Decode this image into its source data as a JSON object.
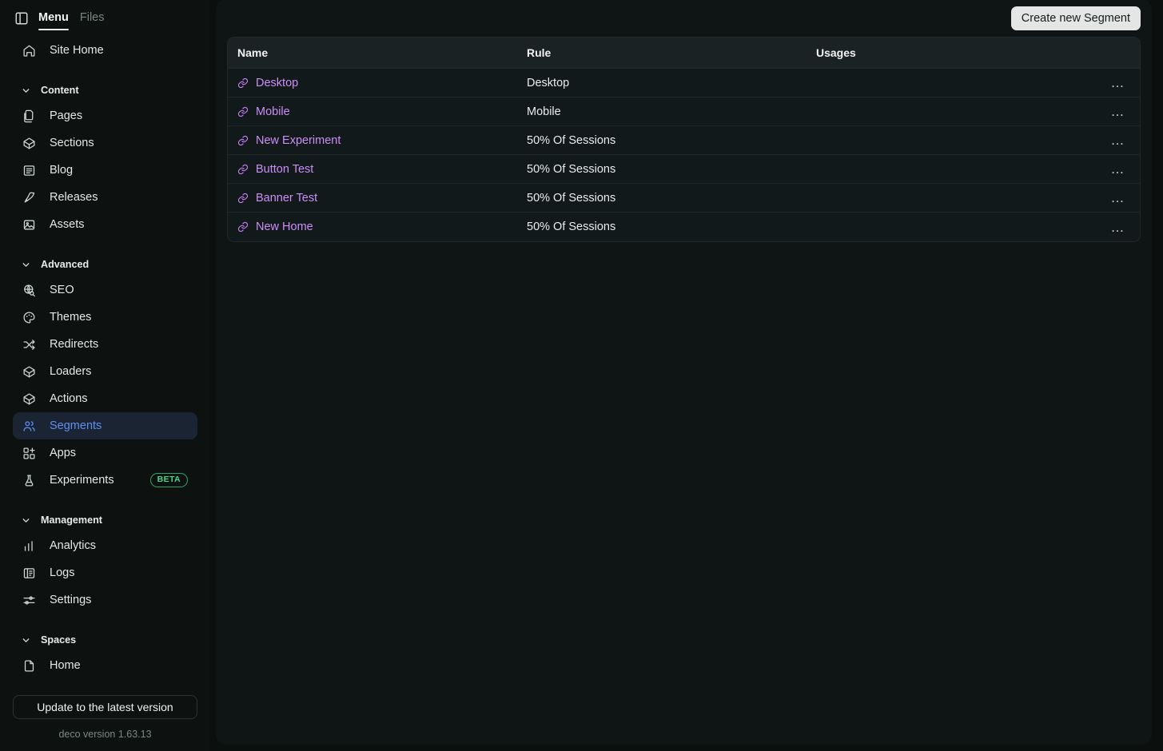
{
  "sidebar": {
    "panel_icon": "panel-toggle-icon",
    "tabs": [
      {
        "label": "Menu",
        "active": true
      },
      {
        "label": "Files",
        "active": false
      }
    ],
    "site_home": {
      "label": "Site Home",
      "icon": "home-icon"
    },
    "groups": [
      {
        "title": "Content",
        "items": [
          {
            "label": "Pages",
            "icon": "pages-icon"
          },
          {
            "label": "Sections",
            "icon": "cube-icon"
          },
          {
            "label": "Blog",
            "icon": "blog-icon"
          },
          {
            "label": "Releases",
            "icon": "rocket-icon"
          },
          {
            "label": "Assets",
            "icon": "image-icon"
          }
        ]
      },
      {
        "title": "Advanced",
        "items": [
          {
            "label": "SEO",
            "icon": "globe-search-icon"
          },
          {
            "label": "Themes",
            "icon": "palette-icon"
          },
          {
            "label": "Redirects",
            "icon": "shuffle-icon"
          },
          {
            "label": "Loaders",
            "icon": "cube-icon"
          },
          {
            "label": "Actions",
            "icon": "cube-icon"
          },
          {
            "label": "Segments",
            "icon": "users-icon",
            "active": true
          },
          {
            "label": "Apps",
            "icon": "apps-grid-plus-icon"
          },
          {
            "label": "Experiments",
            "icon": "flask-icon",
            "badge": "BETA"
          }
        ]
      },
      {
        "title": "Management",
        "items": [
          {
            "label": "Analytics",
            "icon": "bar-chart-icon"
          },
          {
            "label": "Logs",
            "icon": "logs-icon"
          },
          {
            "label": "Settings",
            "icon": "sliders-icon"
          }
        ]
      },
      {
        "title": "Spaces",
        "items": [
          {
            "label": "Home",
            "icon": "file-icon"
          }
        ]
      }
    ],
    "update_button": "Update to the latest version",
    "version": "deco version 1.63.13"
  },
  "main": {
    "create_button": "Create new Segment",
    "columns": [
      "Name",
      "Rule",
      "Usages",
      ""
    ],
    "rows": [
      {
        "name": "Desktop",
        "rule": "Desktop",
        "usages": "",
        "menu": "…"
      },
      {
        "name": "Mobile",
        "rule": "Mobile",
        "usages": "",
        "menu": "…"
      },
      {
        "name": "New Experiment",
        "rule": "50% Of Sessions",
        "usages": "",
        "menu": "…"
      },
      {
        "name": "Button Test",
        "rule": "50% Of Sessions",
        "usages": "",
        "menu": "…"
      },
      {
        "name": "Banner Test",
        "rule": "50% Of Sessions",
        "usages": "",
        "menu": "…"
      },
      {
        "name": "New Home",
        "rule": "50% Of Sessions",
        "usages": "",
        "menu": "…"
      }
    ]
  },
  "colors": {
    "app_bg": "#0b0f0e",
    "sidebar_bg": "#0d1211",
    "panel_bg": "#0f1514",
    "row_bg": "#11191a",
    "header_bg": "#1b2223",
    "accent_link": "#cb8ff7",
    "accent_active": "#5e8ff5",
    "active_item_bg": "#1b2432",
    "beta_green": "#49d391",
    "button_light": "#e3e6e5"
  }
}
